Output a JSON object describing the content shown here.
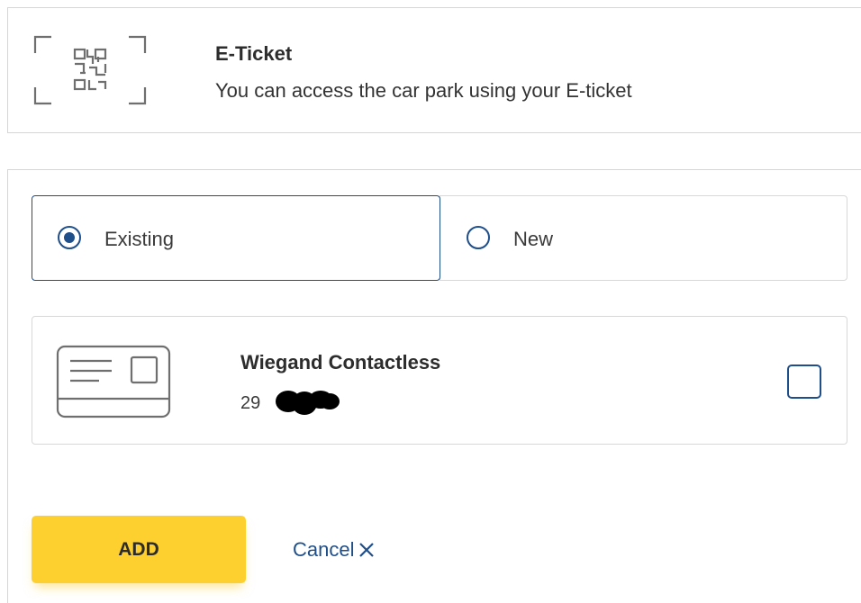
{
  "eticket": {
    "icon": "qr-code-icon",
    "title": "E-Ticket",
    "description": "You can access the car park using your E-ticket"
  },
  "options": {
    "existing_label": "Existing",
    "new_label": "New",
    "selected": "existing"
  },
  "credential": {
    "icon": "access-card-icon",
    "title": "Wiegand Contactless",
    "number_prefix": "29",
    "checked": false
  },
  "actions": {
    "add_label": "ADD",
    "cancel_label": "Cancel",
    "cancel_icon": "close-icon"
  },
  "colors": {
    "accent": "#1f4f8a",
    "button": "#fdd02f",
    "border": "#d8d8d8"
  }
}
